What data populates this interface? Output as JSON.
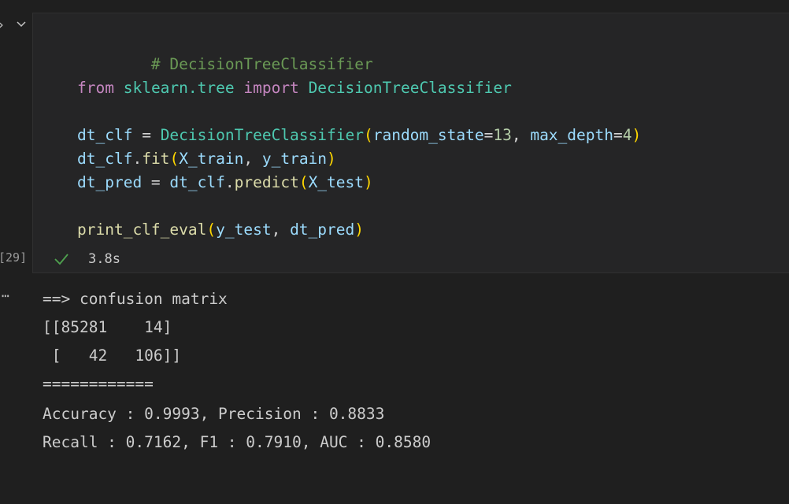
{
  "cell": {
    "gutter_expand_icon": "chevron-right-icon",
    "gutter_collapse_icon": "chevron-down-icon",
    "execution_count": "[29]",
    "status": {
      "icon": "check-icon",
      "duration": "3.8s"
    },
    "output_more_icon": "ellipsis-icon",
    "code": {
      "comment": "# DecisionTreeClassifier",
      "import": {
        "kw_from": "from",
        "module": "sklearn.tree",
        "kw_import": "import",
        "name": "DecisionTreeClassifier"
      },
      "construct": {
        "var": "dt_clf",
        "eq": " = ",
        "cls": "DecisionTreeClassifier",
        "arg1_name": "random_state",
        "arg1_value": "13",
        "arg2_name": "max_depth",
        "arg2_value": "4"
      },
      "fit": {
        "obj": "dt_clf",
        "method": "fit",
        "arg1": "X_train",
        "arg2": "y_train"
      },
      "predict": {
        "var": "dt_pred",
        "obj": "dt_clf",
        "method": "predict",
        "arg": "X_test"
      },
      "print": {
        "func": "print_clf_eval",
        "arg1": "y_test",
        "arg2": "dt_pred"
      }
    },
    "output_lines": [
      "==> confusion matrix",
      "[[85281    14]",
      " [   42   106]]",
      "============",
      "Accuracy : 0.9993, Precision : 0.8833",
      "Recall : 0.7162, F1 : 0.7910, AUC : 0.8580"
    ]
  },
  "colors": {
    "background": "#1f1f1f",
    "cell_background": "#252526",
    "comment": "#6a9955",
    "keyword": "#c586c0",
    "class": "#4ec9b0",
    "variable": "#9cdcfe",
    "function": "#dcdcaa",
    "number": "#b5cea8",
    "bracket": "#ffd700",
    "success_check": "#4fa24f"
  }
}
